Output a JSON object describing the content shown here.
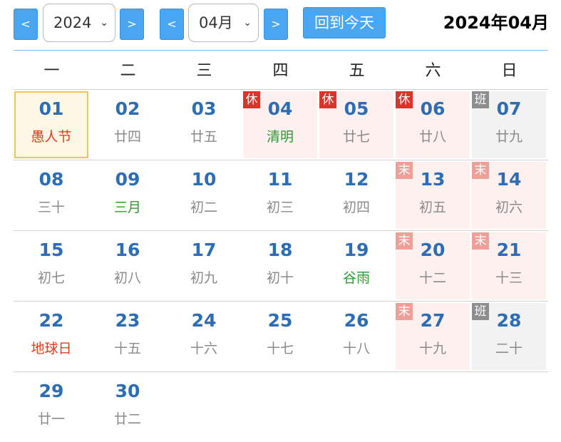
{
  "toolbar": {
    "prev_year": "<",
    "year": "2024",
    "next_year": ">",
    "prev_month": "<",
    "month": "04月",
    "next_month": ">",
    "today": "回到今天",
    "caret": "⌄"
  },
  "title": "2024年04月",
  "weekdays": [
    "一",
    "二",
    "三",
    "四",
    "五",
    "六",
    "日"
  ],
  "badges": {
    "rest": "休",
    "weekend": "末",
    "work": "班"
  },
  "colors": {
    "accent": "#4aa6f0",
    "day": "#2c6db5",
    "festival": "#e53d1c",
    "term": "#2e9a2e",
    "today_border": "#f0c654"
  },
  "weeks": [
    [
      {
        "day": "01",
        "lunar": "愚人节",
        "type": "today",
        "lunar_style": "red"
      },
      {
        "day": "02",
        "lunar": "廿四"
      },
      {
        "day": "03",
        "lunar": "廿五"
      },
      {
        "day": "04",
        "lunar": "清明",
        "type": "holiday",
        "badge": "rest",
        "lunar_style": "green"
      },
      {
        "day": "05",
        "lunar": "廿七",
        "type": "holiday",
        "badge": "rest"
      },
      {
        "day": "06",
        "lunar": "廿八",
        "type": "holiday",
        "badge": "rest"
      },
      {
        "day": "07",
        "lunar": "廿九",
        "type": "work",
        "badge": "work"
      }
    ],
    [
      {
        "day": "08",
        "lunar": "三十"
      },
      {
        "day": "09",
        "lunar": "三月",
        "lunar_style": "green"
      },
      {
        "day": "10",
        "lunar": "初二"
      },
      {
        "day": "11",
        "lunar": "初三"
      },
      {
        "day": "12",
        "lunar": "初四"
      },
      {
        "day": "13",
        "lunar": "初五",
        "type": "weekend",
        "badge": "weekend"
      },
      {
        "day": "14",
        "lunar": "初六",
        "type": "weekend",
        "badge": "weekend"
      }
    ],
    [
      {
        "day": "15",
        "lunar": "初七"
      },
      {
        "day": "16",
        "lunar": "初八"
      },
      {
        "day": "17",
        "lunar": "初九"
      },
      {
        "day": "18",
        "lunar": "初十"
      },
      {
        "day": "19",
        "lunar": "谷雨",
        "lunar_style": "green"
      },
      {
        "day": "20",
        "lunar": "十二",
        "type": "weekend",
        "badge": "weekend"
      },
      {
        "day": "21",
        "lunar": "十三",
        "type": "weekend",
        "badge": "weekend"
      }
    ],
    [
      {
        "day": "22",
        "lunar": "地球日",
        "lunar_style": "red"
      },
      {
        "day": "23",
        "lunar": "十五"
      },
      {
        "day": "24",
        "lunar": "十六"
      },
      {
        "day": "25",
        "lunar": "十七"
      },
      {
        "day": "26",
        "lunar": "十八"
      },
      {
        "day": "27",
        "lunar": "十九",
        "type": "weekend",
        "badge": "weekend"
      },
      {
        "day": "28",
        "lunar": "二十",
        "type": "work",
        "badge": "work"
      }
    ],
    [
      {
        "day": "29",
        "lunar": "廿一"
      },
      {
        "day": "30",
        "lunar": "廿二"
      }
    ]
  ]
}
